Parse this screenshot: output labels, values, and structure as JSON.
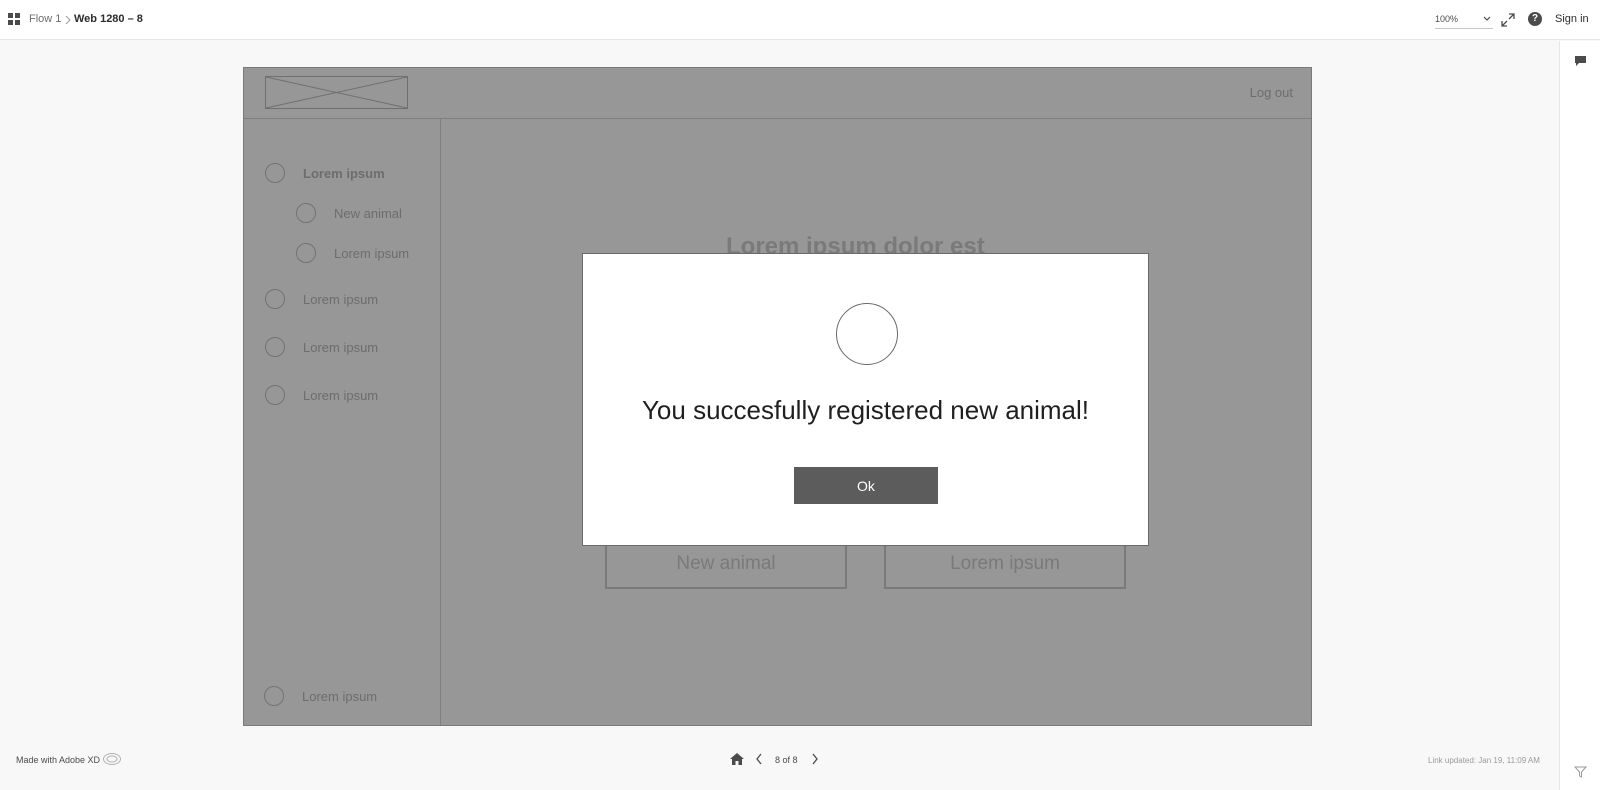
{
  "topbar": {
    "flow_label": "Flow 1",
    "page_label": "Web 1280 – 8",
    "zoom_value": "100%",
    "help_glyph": "?",
    "sign_in_label": "Sign in"
  },
  "artboard": {
    "logout_label": "Log out",
    "sidebar": {
      "items": [
        {
          "label": "Lorem ipsum",
          "bold": true,
          "level": 0
        },
        {
          "label": "New animal",
          "bold": false,
          "level": 1
        },
        {
          "label": "Lorem ipsum",
          "bold": false,
          "level": 1
        },
        {
          "label": "Lorem ipsum",
          "bold": false,
          "level": 0
        },
        {
          "label": "Lorem ipsum",
          "bold": false,
          "level": 0
        },
        {
          "label": "Lorem ipsum",
          "bold": false,
          "level": 0
        }
      ],
      "bottom_item_label": "Lorem ipsum"
    },
    "main_heading": "Lorem ipsum dolor est",
    "buttons": {
      "new_animal_label": "New animal",
      "lorem_label": "Lorem ipsum"
    }
  },
  "modal": {
    "message": "You succesfully registered new animal!",
    "ok_label": "Ok"
  },
  "footer": {
    "made_with": "Made with Adobe XD",
    "page_count": "8 of 8",
    "link_updated": "Link updated: Jan 19, 11:09 AM"
  },
  "icons": {
    "grid": "grid-icon",
    "zoom_chevron": "chevron-down-icon",
    "expand": "expand-icon",
    "help": "help-icon",
    "comment": "comment-icon",
    "filter": "filter-icon",
    "home": "home-icon",
    "prev": "chevron-left-icon",
    "next": "chevron-right-icon",
    "creative_cloud": "creative-cloud-icon"
  },
  "colors": {
    "artboard_bg": "#979797",
    "modal_bg": "#ffffff",
    "ok_button_bg": "#5c5c5c",
    "page_bg": "#f8f8f8"
  }
}
